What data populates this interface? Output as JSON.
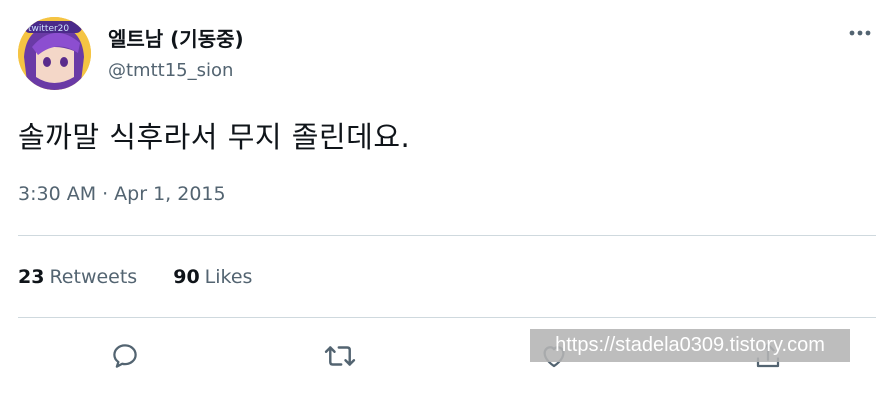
{
  "tweet": {
    "author": {
      "display_name": "엘트남 (기동중)",
      "handle": "@tmtt15_sion",
      "avatar_text": "twitter20"
    },
    "more_icon": "more-horizontal-icon",
    "text": "솔까말 식후라서 무지 졸린데요.",
    "time": "3:30 AM",
    "separator": "·",
    "date": "Apr 1, 2015",
    "stats": {
      "retweets_count": "23",
      "retweets_label": "Retweets",
      "likes_count": "90",
      "likes_label": "Likes"
    },
    "actions": [
      "reply-icon",
      "retweet-icon",
      "like-icon",
      "share-icon"
    ]
  },
  "watermark": "https://stadela0309.tistory.com",
  "colors": {
    "text_primary": "#0f1419",
    "text_secondary": "#536471",
    "divider": "#cfd9de",
    "avatar_hair": "#7b3fb3"
  }
}
